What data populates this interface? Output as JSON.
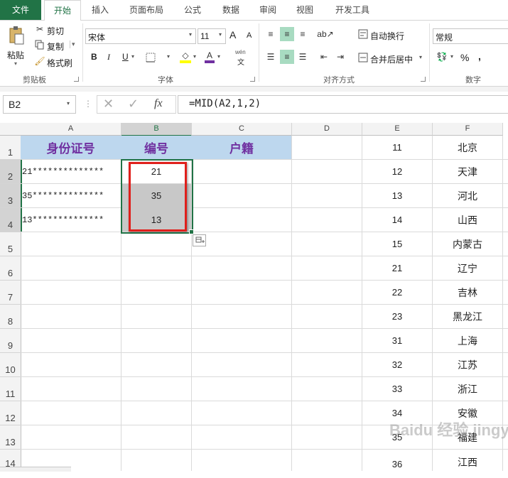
{
  "tabs": [
    "文件",
    "开始",
    "插入",
    "页面布局",
    "公式",
    "数据",
    "审阅",
    "视图",
    "开发工具"
  ],
  "clipboard": {
    "cut": "剪切",
    "copy": "复制",
    "format_painter": "格式刷",
    "paste": "粘贴",
    "group": "剪贴板"
  },
  "font": {
    "name": "宋体",
    "size": "11",
    "bold": "B",
    "italic": "I",
    "underline": "U",
    "grow": "A",
    "shrink": "A",
    "phonetic": "wén",
    "group": "字体"
  },
  "alignment": {
    "wrap": "自动换行",
    "merge": "合并后居中",
    "group": "对齐方式"
  },
  "number": {
    "format": "常规",
    "percent": "%",
    "comma": ",",
    "group": "数字"
  },
  "formula_bar": {
    "name_box": "B2",
    "fx": "fx",
    "formula": "=MID(A2,1,2)"
  },
  "columns": [
    "A",
    "B",
    "C",
    "D",
    "E",
    "F"
  ],
  "rows": [
    "1",
    "2",
    "3",
    "4",
    "5",
    "6",
    "7",
    "8",
    "9",
    "10",
    "11",
    "12",
    "13",
    "14"
  ],
  "headers": {
    "a1": "身份证号",
    "b1": "编号",
    "c1": "户籍"
  },
  "ids": [
    "21**************",
    "35**************",
    "13**************"
  ],
  "codes": [
    "21",
    "35",
    "13"
  ],
  "lookup": [
    {
      "code": "11",
      "place": "北京"
    },
    {
      "code": "12",
      "place": "天津"
    },
    {
      "code": "13",
      "place": "河北"
    },
    {
      "code": "14",
      "place": "山西"
    },
    {
      "code": "15",
      "place": "内蒙古"
    },
    {
      "code": "21",
      "place": "辽宁"
    },
    {
      "code": "22",
      "place": "吉林"
    },
    {
      "code": "23",
      "place": "黑龙江"
    },
    {
      "code": "31",
      "place": "上海"
    },
    {
      "code": "32",
      "place": "江苏"
    },
    {
      "code": "33",
      "place": "浙江"
    },
    {
      "code": "34",
      "place": "安徽"
    },
    {
      "code": "35",
      "place": "福建"
    },
    {
      "code": "36",
      "place": "江西"
    }
  ],
  "watermark": "Baidu 经验 jingyan.baidu.com",
  "colors": {
    "excel_green": "#217346",
    "header_fill": "#bdd7ee",
    "header_text": "#7030a0",
    "selection": "#c8c8c8",
    "highlight_box": "#e0201c"
  }
}
